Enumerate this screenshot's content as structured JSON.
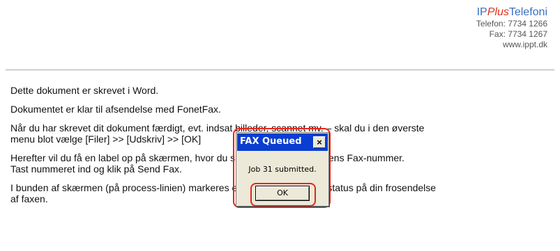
{
  "letterhead": {
    "brand_prefix": "IP",
    "brand_plus": "Plus",
    "brand_suffix": "Telefoni",
    "phone": "Telefon: 7734 1266",
    "fax": "Fax: 7734 1267",
    "website": "www.ippt.dk"
  },
  "document": {
    "paragraphs": [
      "Dette dokument er skrevet i Word.",
      "Dokumentet er klar til afsendelse med FonetFax.",
      "Når du har skrevet dit dokument færdigt, evt. indsat billeder, scannet mv. – skal du i den øverste\nmenu blot vælge [Filer] >> [Udskriv] >> [OK]",
      "Herefter vil du få en label op på skærmen, hvor du skal indtaste modtagerens Fax-nummer.\nTast nummeret ind og klik på Send Fax.",
      "I bunden af skærmen (på process-linien) markeres en ny process. Det er status på din frosendelse\naf faxen."
    ]
  },
  "dialog": {
    "title": "FAX Queued",
    "close_glyph": "×",
    "message": "Job 31 submitted.",
    "ok_label": "OK"
  },
  "colors": {
    "brand_blue": "#3a6fc0",
    "brand_red": "#e0311f",
    "titlebar_blue": "#0a3ed0",
    "highlight_red": "#e8241a"
  }
}
